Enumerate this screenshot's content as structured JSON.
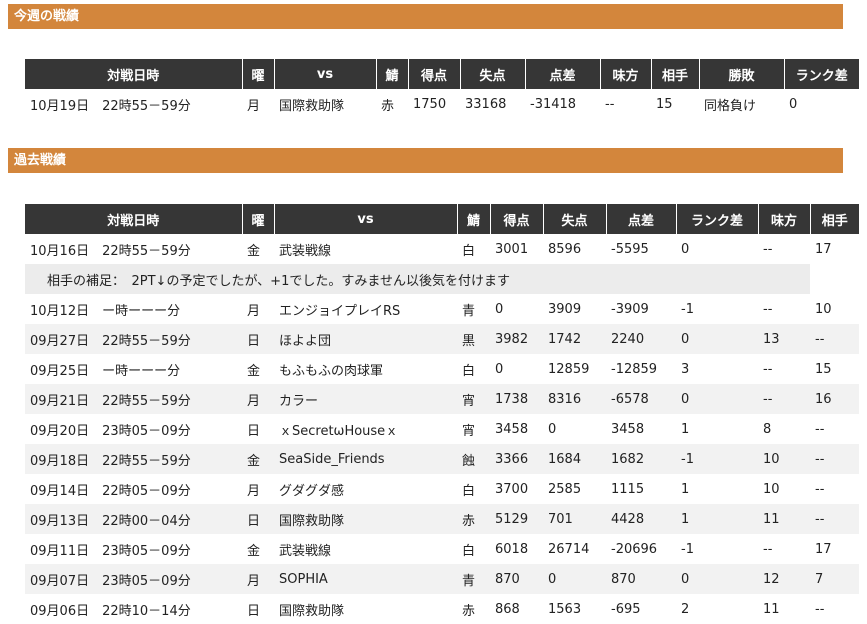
{
  "this_week": {
    "title": "今週の戦績",
    "headers": [
      "対戦日時",
      "曜",
      "vs",
      "鯖",
      "得点",
      "失点",
      "点差",
      "味方",
      "相手",
      "勝敗",
      "ランク差"
    ],
    "rows": [
      [
        "10月19日　22時55－59分",
        "月",
        "国際救助隊",
        "赤",
        "1750",
        "33168",
        "-31418",
        "--",
        "15",
        "同格負け",
        "0"
      ]
    ]
  },
  "past": {
    "title": "過去戦績",
    "headers": [
      "対戦日時",
      "曜",
      "vs",
      "鯖",
      "得点",
      "失点",
      "点差",
      "ランク差",
      "味方",
      "相手"
    ],
    "rows": [
      [
        "10月16日　22時55－59分",
        "金",
        "武装戦線",
        "白",
        "3001",
        "8596",
        "-5595",
        "0",
        "--",
        "17"
      ],
      [
        "09月27日　22時55－59分",
        "日",
        "ほよよ団",
        "黒",
        "3982",
        "1742",
        "2240",
        "0",
        "13",
        "--"
      ],
      [
        "09月25日　ー時ーーー分",
        "金",
        "もふもふの肉球軍",
        "白",
        "0",
        "12859",
        "-12859",
        "3",
        "--",
        "15"
      ],
      [
        "09月21日　22時55－59分",
        "月",
        "カラー",
        "宵",
        "1738",
        "8316",
        "-6578",
        "0",
        "--",
        "16"
      ],
      [
        "09月20日　23時05－09分",
        "日",
        "ｘSecretωHouseｘ",
        "宵",
        "3458",
        "0",
        "3458",
        "1",
        "8",
        "--"
      ],
      [
        "09月18日　22時55－59分",
        "金",
        "SeaSide_Friends",
        "蝕",
        "3366",
        "1684",
        "1682",
        "-1",
        "10",
        "--"
      ],
      [
        "09月14日　22時05－09分",
        "月",
        "グダグダ感",
        "白",
        "3700",
        "2585",
        "1115",
        "1",
        "10",
        "--"
      ],
      [
        "09月13日　22時00－04分",
        "日",
        "国際救助隊",
        "赤",
        "5129",
        "701",
        "4428",
        "1",
        "11",
        "--"
      ],
      [
        "09月11日　23時05－09分",
        "金",
        "武装戦線",
        "白",
        "6018",
        "26714",
        "-20696",
        "-1",
        "--",
        "17"
      ],
      [
        "09月07日　23時05－09分",
        "月",
        "SOPHIA",
        "青",
        "870",
        "0",
        "870",
        "0",
        "12",
        "7"
      ],
      [
        "09月06日　22時10－14分",
        "日",
        "国際救助隊",
        "赤",
        "868",
        "1563",
        "-695",
        "2",
        "11",
        "--"
      ]
    ],
    "note": "相手の補足：　2PT↓の予定でしたが、+1でした。すみません以後気を付けます",
    "row_after_note": [
      "10月12日　ー時ーーー分",
      "月",
      "エンジョイプレイRS",
      "青",
      "0",
      "3909",
      "-3909",
      "-1",
      "--",
      "10"
    ]
  },
  "colors": {
    "section_bar": "#d3863c",
    "header_bg": "#363636",
    "row_alt": "#f2f2f2"
  }
}
